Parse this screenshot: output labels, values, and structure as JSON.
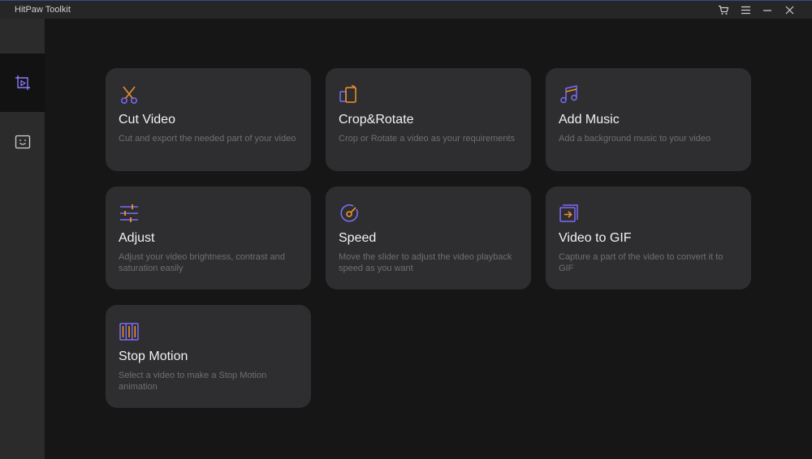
{
  "app": {
    "title": "HitPaw Toolkit"
  },
  "titlebar": {
    "controls": [
      {
        "name": "cart-icon"
      },
      {
        "name": "menu-icon"
      },
      {
        "name": "minimize-icon"
      },
      {
        "name": "close-icon"
      }
    ]
  },
  "sidebar": {
    "items": [
      {
        "name": "video-tools-icon",
        "active": true
      },
      {
        "name": "face-tools-icon",
        "active": false
      }
    ]
  },
  "colors": {
    "accent_purple": "#7b6cf6",
    "accent_orange": "#f0932b",
    "background": "#161616",
    "card": "#2e2e30"
  },
  "tools": [
    {
      "id": "cut-video",
      "icon": "scissors-icon",
      "name": "Cut Video",
      "description": "Cut and export the needed part of your video"
    },
    {
      "id": "crop-rotate",
      "icon": "crop-rotate-icon",
      "name": "Crop&Rotate",
      "description": "Crop or Rotate a video as your requirements"
    },
    {
      "id": "add-music",
      "icon": "music-note-icon",
      "name": "Add Music",
      "description": "Add a background music to your video"
    },
    {
      "id": "adjust",
      "icon": "sliders-icon",
      "name": "Adjust",
      "description": "Adjust your video brightness, contrast and saturation easily"
    },
    {
      "id": "speed",
      "icon": "speedometer-icon",
      "name": "Speed",
      "description": "Move the slider to adjust the video playback speed as you want"
    },
    {
      "id": "video-to-gif",
      "icon": "gif-export-icon",
      "name": "Video to GIF",
      "description": "Capture a part of the video to convert it to GIF"
    },
    {
      "id": "stop-motion",
      "icon": "film-frames-icon",
      "name": "Stop Motion",
      "description": "Select a video to make a Stop Motion animation"
    }
  ]
}
